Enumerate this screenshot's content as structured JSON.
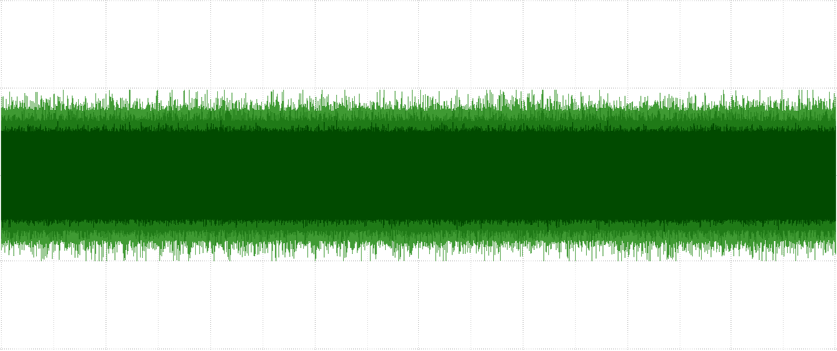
{
  "waveform": {
    "colors": {
      "background": "#ffffff",
      "grid_minor": "#d9d9d9",
      "grid_major": "#bdbdbd",
      "waveform_core": "#014a00",
      "waveform_peaks": "#3f9a33",
      "waveform_peak_fill": "#1f7a17"
    },
    "grid": {
      "visible": true,
      "style": "dotted",
      "vertical_divisions": 16,
      "horizontal_divisions": 4
    },
    "signal": {
      "kind": "noise",
      "amplitude_core": 0.45,
      "amplitude_peak_max": 0.98
    }
  }
}
